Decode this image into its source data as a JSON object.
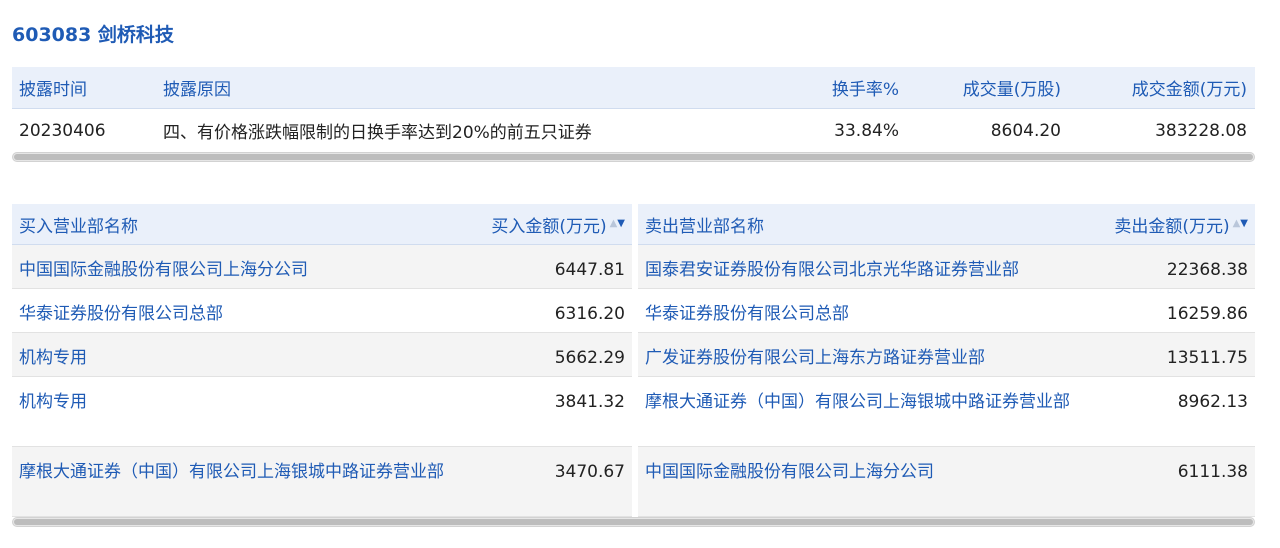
{
  "title": "603083 剑桥科技",
  "disclosure": {
    "headers": {
      "date": "披露时间",
      "reason": "披露原因",
      "turnover": "换手率%",
      "volume": "成交量(万股)",
      "amount": "成交金额(万元)"
    },
    "row": {
      "date": "20230406",
      "reason": "四、有价格涨跌幅限制的日换手率达到20%的前五只证券",
      "turnover": "33.84%",
      "volume": "8604.20",
      "amount": "383228.08"
    }
  },
  "buy": {
    "header_name": "买入营业部名称",
    "header_amount": "买入金额(万元)",
    "rows": [
      {
        "name": "中国国际金融股份有限公司上海分公司",
        "amount": "6447.81"
      },
      {
        "name": "华泰证券股份有限公司总部",
        "amount": "6316.20"
      },
      {
        "name": "机构专用",
        "amount": "5662.29"
      },
      {
        "name": "机构专用",
        "amount": "3841.32"
      },
      {
        "name": "摩根大通证券（中国）有限公司上海银城中路证券营业部",
        "amount": "3470.67"
      }
    ]
  },
  "sell": {
    "header_name": "卖出营业部名称",
    "header_amount": "卖出金额(万元)",
    "rows": [
      {
        "name": "国泰君安证券股份有限公司北京光华路证券营业部",
        "amount": "22368.38"
      },
      {
        "name": "华泰证券股份有限公司总部",
        "amount": "16259.86"
      },
      {
        "name": "广发证券股份有限公司上海东方路证券营业部",
        "amount": "13511.75"
      },
      {
        "name": "摩根大通证券（中国）有限公司上海银城中路证券营业部",
        "amount": "8962.13"
      },
      {
        "name": "中国国际金融股份有限公司上海分公司",
        "amount": "6111.38"
      }
    ]
  },
  "sort_icon": {
    "up": "▲",
    "down": "▼"
  },
  "colors": {
    "accent": "#1f5bb5",
    "header_bg": "#eaf0fa",
    "row_alt": "#f4f4f4"
  }
}
